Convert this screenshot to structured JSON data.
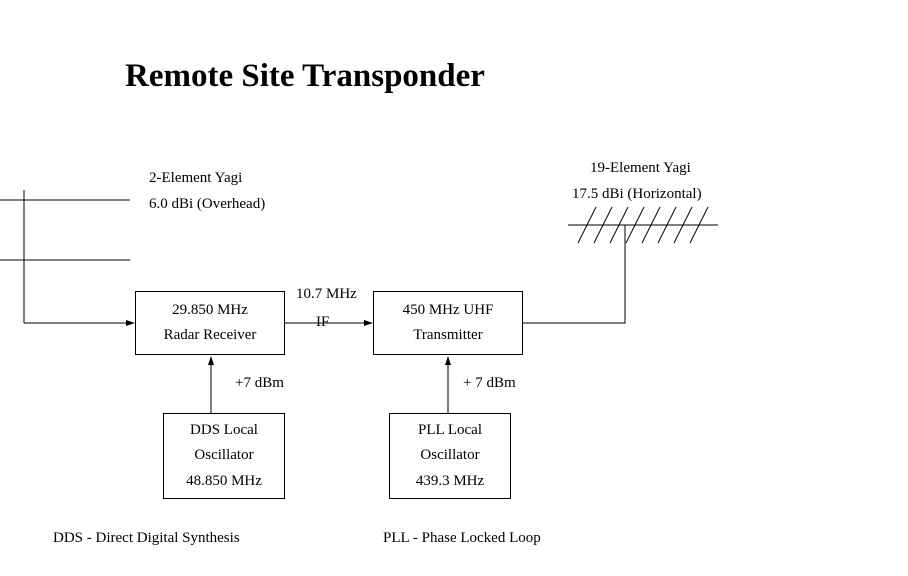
{
  "title": "Remote Site Transponder",
  "antenna_rx": {
    "name": "2-Element Yagi",
    "gain": "6.0 dBi (Overhead)"
  },
  "antenna_tx": {
    "name": "19-Element Yagi",
    "gain": "17.5 dBi (Horizontal)"
  },
  "receiver": {
    "freq": "29.850 MHz",
    "role": "Radar Receiver"
  },
  "transmitter": {
    "freq": "450 MHz UHF",
    "role": "Transmitter"
  },
  "if_link": {
    "freq": "10.7 MHz",
    "label": "IF"
  },
  "lo_dds": {
    "name": "DDS Local",
    "role": "Oscillator",
    "freq": "48.850 MHz",
    "level": "+7 dBm"
  },
  "lo_pll": {
    "name": "PLL Local",
    "role": "Oscillator",
    "freq": "439.3 MHz",
    "level": "+ 7 dBm"
  },
  "glossary": {
    "dds": "DDS - Direct Digital Synthesis",
    "pll": "PLL - Phase Locked Loop"
  }
}
